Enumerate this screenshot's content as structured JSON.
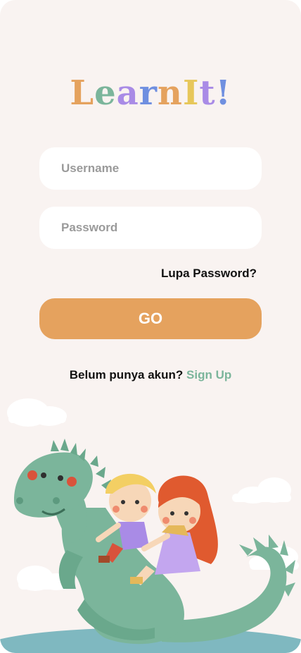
{
  "logo": {
    "letters": [
      {
        "char": "L",
        "color": "#e5a25e"
      },
      {
        "char": "e",
        "color": "#7bb59b"
      },
      {
        "char": "a",
        "color": "#a98be6"
      },
      {
        "char": "r",
        "color": "#6f8fe0"
      },
      {
        "char": "n",
        "color": "#e5a25e"
      },
      {
        "char": "I",
        "color": "#e7c75a"
      },
      {
        "char": "t",
        "color": "#a98be6"
      },
      {
        "char": "!",
        "color": "#6f8fe0"
      }
    ]
  },
  "form": {
    "username_placeholder": "Username",
    "password_placeholder": "Password",
    "forgot_label": "Lupa Password?",
    "go_label": "GO"
  },
  "signup": {
    "prompt": "Belum punya akun?",
    "link": "Sign Up"
  },
  "colors": {
    "background": "#f9f3f1",
    "accent": "#e5a25e",
    "link": "#7bb59b",
    "dragon": "#7bb59b"
  }
}
